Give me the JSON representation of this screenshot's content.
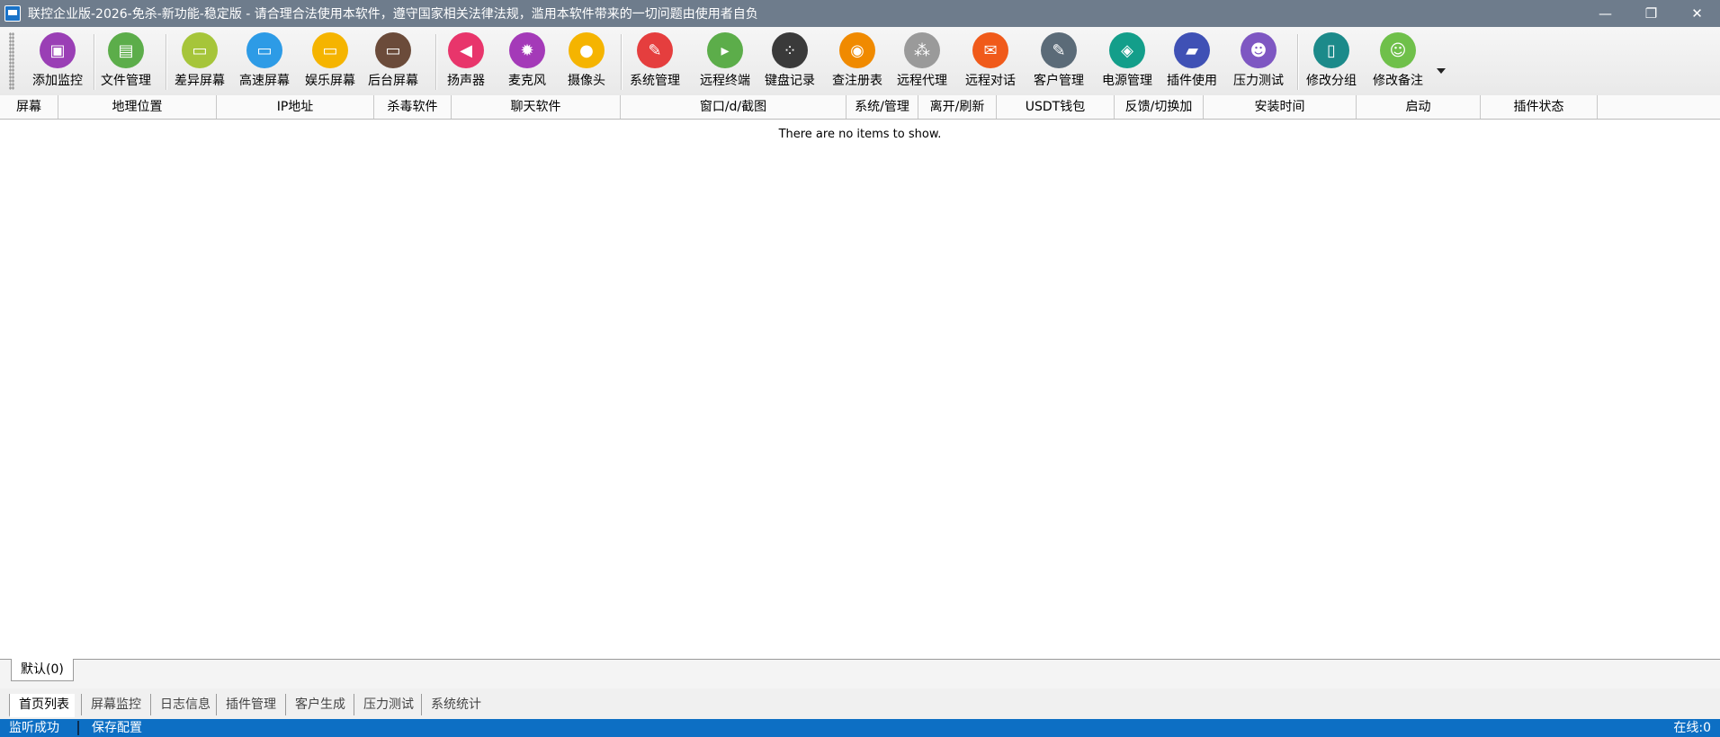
{
  "window": {
    "title": "联控企业版-2026-免杀-新功能-稳定版 - 请合理合法使用本软件，遵守国家相关法律法规，滥用本软件带来的一切问题由使用者自负",
    "controls": {
      "minimize": "—",
      "restore": "❐",
      "close": "✕"
    }
  },
  "toolbar": {
    "items": [
      {
        "label": "添加监控",
        "icon": "add-monitor-icon",
        "glyph": "▣",
        "color": "#9a3fb5"
      },
      {
        "label": "文件管理",
        "icon": "file-icon",
        "glyph": "▤",
        "color": "#5cad4a"
      },
      {
        "label": "差异屏幕",
        "icon": "diff-screen-icon",
        "glyph": "▭",
        "color": "#a6c53a"
      },
      {
        "label": "高速屏幕",
        "icon": "fast-screen-icon",
        "glyph": "▭",
        "color": "#2d9be6"
      },
      {
        "label": "娱乐屏幕",
        "icon": "fun-screen-icon",
        "glyph": "▭",
        "color": "#f5b400"
      },
      {
        "label": "后台屏幕",
        "icon": "background-screen-icon",
        "glyph": "▭",
        "color": "#6b4b3a"
      },
      {
        "label": "扬声器",
        "icon": "speaker-icon",
        "glyph": "◀",
        "color": "#e8356b"
      },
      {
        "label": "麦克风",
        "icon": "microphone-icon",
        "glyph": "✹",
        "color": "#a43ab8"
      },
      {
        "label": "摄像头",
        "icon": "camera-icon",
        "glyph": "●",
        "color": "#f5b400"
      },
      {
        "label": "系统管理",
        "icon": "system-manage-icon",
        "glyph": "✎",
        "color": "#e53e3e"
      },
      {
        "label": "远程终端",
        "icon": "terminal-icon",
        "glyph": "▸",
        "color": "#5cad4a"
      },
      {
        "label": "键盘记录",
        "icon": "keyboard-log-icon",
        "glyph": "⁘",
        "color": "#3a3a3a"
      },
      {
        "label": "查注册表",
        "icon": "registry-icon",
        "glyph": "◉",
        "color": "#f08a00"
      },
      {
        "label": "远程代理",
        "icon": "proxy-icon",
        "glyph": "⁂",
        "color": "#9a9a9a"
      },
      {
        "label": "远程对话",
        "icon": "chat-icon",
        "glyph": "✉",
        "color": "#f05a1a"
      },
      {
        "label": "客户管理",
        "icon": "edit-client-icon",
        "glyph": "✎",
        "color": "#5b6b78"
      },
      {
        "label": "电源管理",
        "icon": "power-shield-icon",
        "glyph": "◈",
        "color": "#139e8a"
      },
      {
        "label": "插件使用",
        "icon": "plugin-icon",
        "glyph": "▰",
        "color": "#3f51b5"
      },
      {
        "label": "压力测试",
        "icon": "stress-test-icon",
        "glyph": "☻",
        "color": "#7e57c2"
      },
      {
        "label": "修改分组",
        "icon": "change-group-icon",
        "glyph": "▯",
        "color": "#1c8a8a"
      },
      {
        "label": "修改备注",
        "icon": "change-note-icon",
        "glyph": "☺",
        "color": "#6fc04a"
      }
    ]
  },
  "table": {
    "columns": [
      "屏幕",
      "地理位置",
      "IP地址",
      "杀毒软件",
      "聊天软件",
      "窗口/d/截图",
      "系统/管理",
      "离开/刷新",
      "USDT钱包",
      "反馈/切换加",
      "安装时间",
      "启动",
      "插件状态"
    ],
    "empty_message": "There are no items to show."
  },
  "group_tabs": [
    {
      "label": "默认(0)"
    }
  ],
  "nav_tabs": [
    "首页列表",
    "屏幕监控",
    "日志信息",
    "插件管理",
    "客户生成",
    "压力测试",
    "系统统计"
  ],
  "status": {
    "listen": "监听成功",
    "save": "保存配置",
    "online": "在线:0"
  }
}
